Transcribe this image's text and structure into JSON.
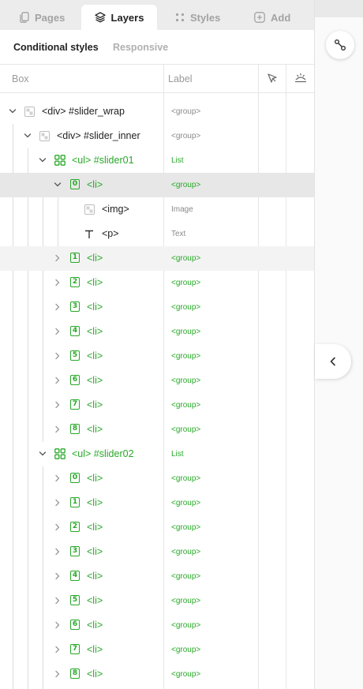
{
  "tabs": [
    {
      "label": "Pages",
      "icon": "pages-icon",
      "active": false
    },
    {
      "label": "Layers",
      "icon": "layers-icon",
      "active": true
    },
    {
      "label": "Styles",
      "icon": "styles-icon",
      "active": false
    },
    {
      "label": "Add",
      "icon": "add-icon",
      "active": false
    }
  ],
  "subtabs": {
    "conditional": "Conditional styles",
    "responsive": "Responsive"
  },
  "columns": {
    "box": "Box",
    "label": "Label",
    "icon1": "pointer-icon",
    "icon2": "visibility-icon"
  },
  "tree": [
    {
      "text": "<div> #slider_wrap",
      "label": "<group>",
      "kind": "div",
      "state": "normal"
    },
    {
      "text": "<div> #slider_inner",
      "label": "<group>",
      "kind": "div",
      "state": "normal"
    },
    {
      "text": "<ul> #slider01",
      "label": "List",
      "kind": "ul",
      "state": "normal"
    },
    {
      "text": "<li>",
      "label": "<group>",
      "kind": "li",
      "num": "0",
      "state": "selected"
    },
    {
      "text": "<img>",
      "label": "Image",
      "kind": "img",
      "state": "normal"
    },
    {
      "text": "<p>",
      "label": "Text",
      "kind": "p",
      "state": "normal"
    },
    {
      "text": "<li>",
      "label": "<group>",
      "kind": "li",
      "num": "1",
      "state": "hover"
    },
    {
      "text": "<li>",
      "label": "<group>",
      "kind": "li",
      "num": "2",
      "state": "normal"
    },
    {
      "text": "<li>",
      "label": "<group>",
      "kind": "li",
      "num": "3",
      "state": "normal"
    },
    {
      "text": "<li>",
      "label": "<group>",
      "kind": "li",
      "num": "4",
      "state": "normal"
    },
    {
      "text": "<li>",
      "label": "<group>",
      "kind": "li",
      "num": "5",
      "state": "normal"
    },
    {
      "text": "<li>",
      "label": "<group>",
      "kind": "li",
      "num": "6",
      "state": "normal"
    },
    {
      "text": "<li>",
      "label": "<group>",
      "kind": "li",
      "num": "7",
      "state": "normal"
    },
    {
      "text": "<li>",
      "label": "<group>",
      "kind": "li",
      "num": "8",
      "state": "normal"
    },
    {
      "text": "<ul> #slider02",
      "label": "List",
      "kind": "ul",
      "state": "normal"
    },
    {
      "text": "<li>",
      "label": "<group>",
      "kind": "li",
      "num": "0",
      "state": "normal"
    },
    {
      "text": "<li>",
      "label": "<group>",
      "kind": "li",
      "num": "1",
      "state": "normal"
    },
    {
      "text": "<li>",
      "label": "<group>",
      "kind": "li",
      "num": "2",
      "state": "normal"
    },
    {
      "text": "<li>",
      "label": "<group>",
      "kind": "li",
      "num": "3",
      "state": "normal"
    },
    {
      "text": "<li>",
      "label": "<group>",
      "kind": "li",
      "num": "4",
      "state": "normal"
    },
    {
      "text": "<li>",
      "label": "<group>",
      "kind": "li",
      "num": "5",
      "state": "normal"
    },
    {
      "text": "<li>",
      "label": "<group>",
      "kind": "li",
      "num": "6",
      "state": "normal"
    },
    {
      "text": "<li>",
      "label": "<group>",
      "kind": "li",
      "num": "7",
      "state": "normal"
    },
    {
      "text": "<li>",
      "label": "<group>",
      "kind": "li",
      "num": "8",
      "state": "normal"
    }
  ],
  "right": {
    "connect_icon": "connect-icon",
    "collapse_icon": "chevron-left-icon"
  },
  "colors": {
    "accent_green": "#28a828",
    "selected_row": "#e7e7e7",
    "hover_row": "#f3f3f3"
  }
}
